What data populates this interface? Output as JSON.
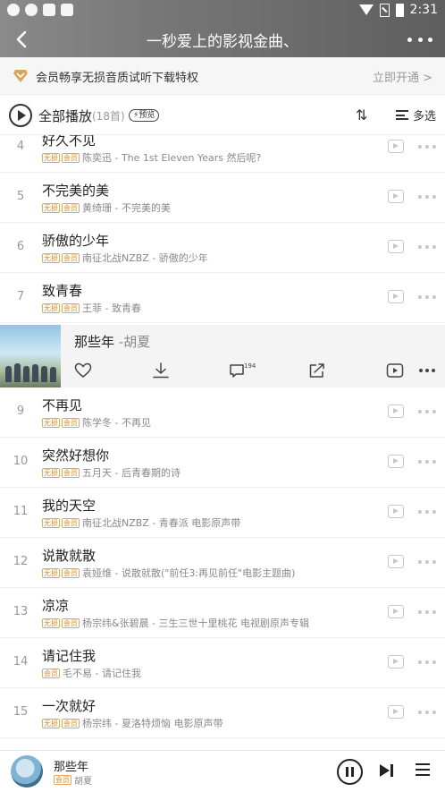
{
  "status_bar": {
    "time": "2:31"
  },
  "nav": {
    "title": "一秒爱上的影视金曲、"
  },
  "vip_banner": {
    "text": "会员畅享无损音质试听下载特权",
    "cta": "立即开通 >"
  },
  "play_all": {
    "label": "全部播放",
    "count": "(18首)",
    "preview_badge": "预览"
  },
  "toolbar": {
    "sort_label": "⇅",
    "multi_select_label": "多选"
  },
  "current_song": {
    "title": "那些年",
    "artist": "-胡夏",
    "comment_count": "194"
  },
  "songs": [
    {
      "num": "4",
      "title": "好久不见",
      "tags": [
        "无损",
        "会员"
      ],
      "artist": "陈奕迅 - The 1st Eleven Years 然后呢?"
    },
    {
      "num": "5",
      "title": "不完美的美",
      "tags": [
        "无损",
        "会员"
      ],
      "artist": "黄绮珊 - 不完美的美"
    },
    {
      "num": "6",
      "title": "骄傲的少年",
      "tags": [
        "无损",
        "会员"
      ],
      "artist": "南征北战NZBZ - 骄傲的少年"
    },
    {
      "num": "7",
      "title": "致青春",
      "tags": [
        "无损",
        "会员"
      ],
      "artist": "王菲 - 致青春"
    },
    {
      "num": "9",
      "title": "不再见",
      "tags": [
        "无损",
        "会员"
      ],
      "artist": "陈学冬 - 不再见"
    },
    {
      "num": "10",
      "title": "突然好想你",
      "tags": [
        "无损",
        "会员"
      ],
      "artist": "五月天 - 后青春期的诗"
    },
    {
      "num": "11",
      "title": "我的天空",
      "tags": [
        "无损",
        "会员"
      ],
      "artist": "南征北战NZBZ - 青春派 电影原声带"
    },
    {
      "num": "12",
      "title": "说散就散",
      "tags": [
        "无损",
        "会员"
      ],
      "artist": "袁娅维 - 说散就散(\"前任3:再见前任\"电影主题曲)"
    },
    {
      "num": "13",
      "title": "凉凉",
      "tags": [
        "无损",
        "会员"
      ],
      "artist": "杨宗纬&张碧晨 - 三生三世十里桃花 电视剧原声专辑"
    },
    {
      "num": "14",
      "title": "请记住我",
      "tags": [
        "会员"
      ],
      "artist": "毛不易 - 请记住我"
    },
    {
      "num": "15",
      "title": "一次就好",
      "tags": [
        "无损",
        "会员"
      ],
      "artist": "杨宗纬 - 夏洛特烦恼 电影原声带"
    }
  ],
  "mini_player": {
    "title": "那些年",
    "tag": "会员",
    "artist": "胡夏"
  },
  "colors": {
    "tag": "#d88b2c",
    "header_bg": "#777777"
  }
}
